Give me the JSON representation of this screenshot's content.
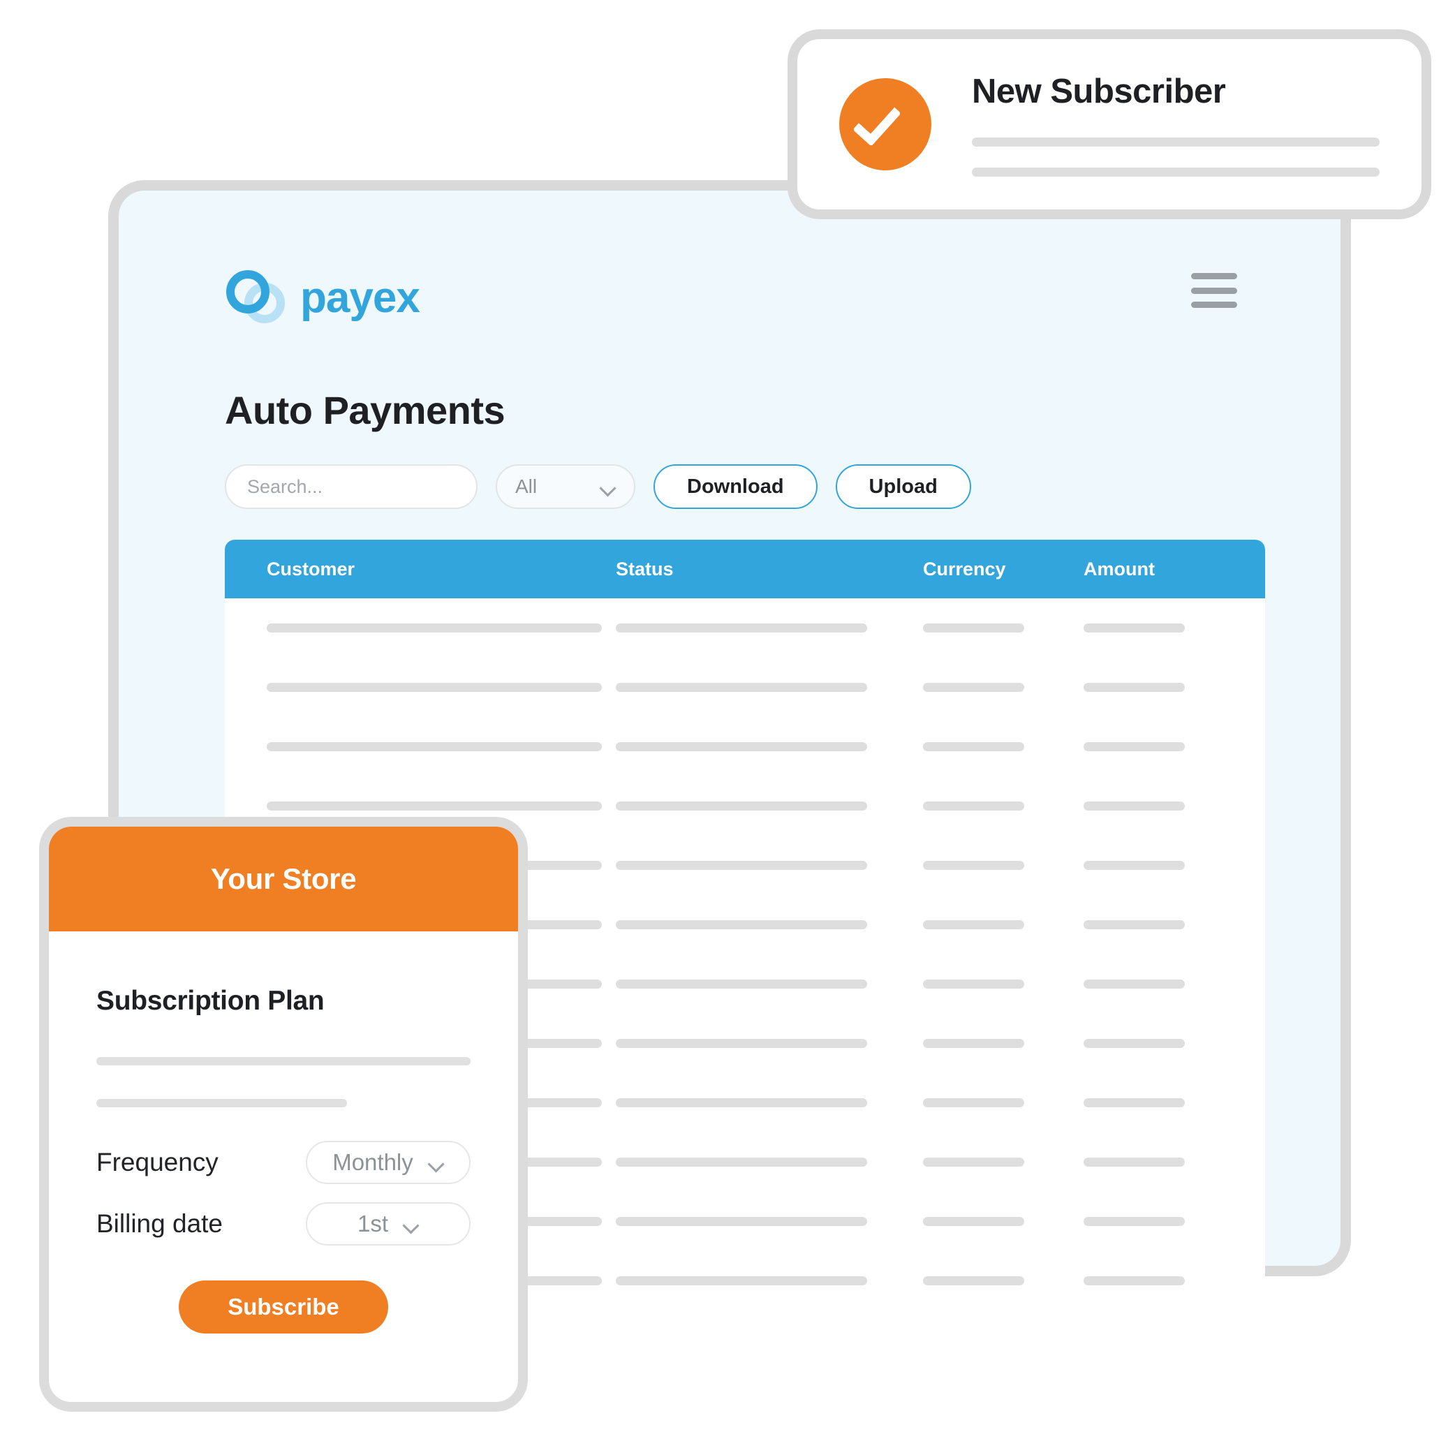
{
  "dashboard": {
    "brand": {
      "name": "payex",
      "logo_icon": "payex-double-circle-icon",
      "color": "#31a5dc"
    },
    "menu_icon": "hamburger-menu-icon",
    "page_title": "Auto Payments",
    "toolbar": {
      "search_placeholder": "Search...",
      "search_value": "",
      "filter_value": "All",
      "filter_chevron_icon": "chevron-down-icon",
      "download_label": "Download",
      "upload_label": "Upload",
      "button_border_color": "#31a5dc"
    },
    "table": {
      "header_color": "#31a5dc",
      "columns": [
        "Customer",
        "Status",
        "Currency",
        "Amount"
      ],
      "row_count": 12,
      "placeholder_color": "#dedede"
    },
    "panel_bg": "#eff8fc",
    "panel_border": "#d9d9d9"
  },
  "notification": {
    "status_icon": "check-circle-icon",
    "status_color": "#f07f23",
    "title": "New Subscriber",
    "placeholder_lines": [
      100,
      100
    ]
  },
  "store_card": {
    "header_title": "Your Store",
    "header_color": "#f07f23",
    "plan_heading": "Subscription Plan",
    "placeholder_lines": [
      100,
      67
    ],
    "fields": [
      {
        "label": "Frequency",
        "value": "Monthly",
        "chevron_icon": "chevron-down-icon"
      },
      {
        "label": "Billing date",
        "value": "1st",
        "chevron_icon": "chevron-down-icon"
      }
    ],
    "subscribe_label": "Subscribe"
  }
}
